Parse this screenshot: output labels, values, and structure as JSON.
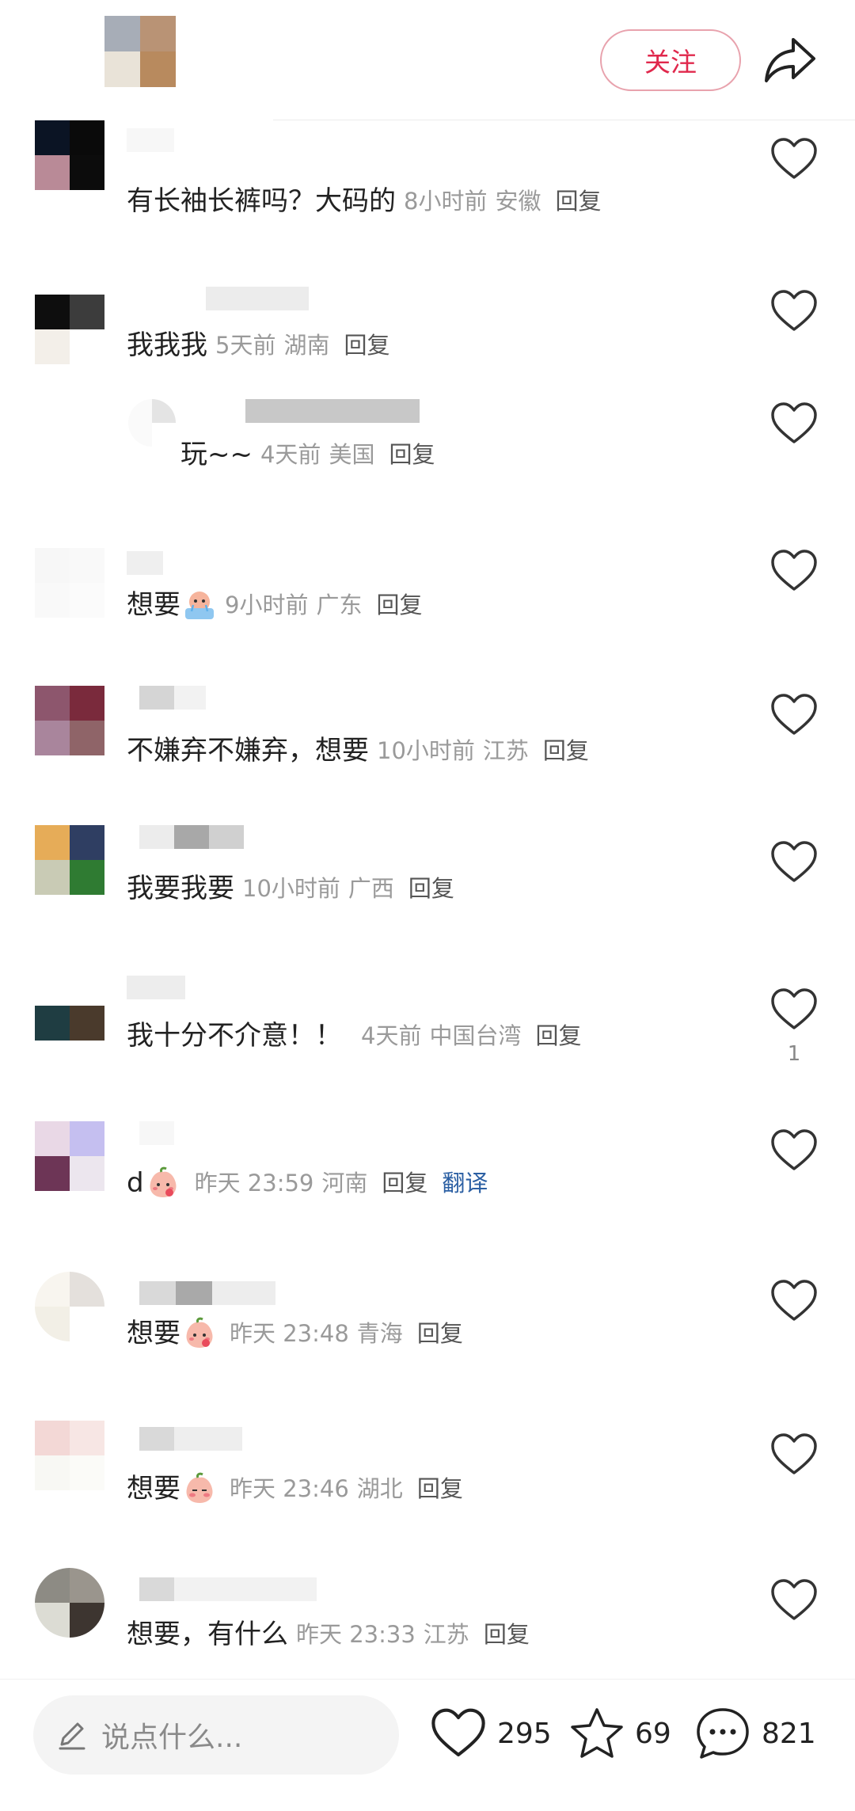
{
  "header": {
    "follow_label": "关注"
  },
  "comments": [
    {
      "text": "有长袖长裤吗？大码的",
      "time": "8小时前",
      "location": "安徽",
      "reply": "回复",
      "like_count": ""
    },
    {
      "text": "我我我",
      "time": "5天前",
      "location": "湖南",
      "reply": "回复",
      "like_count": ""
    },
    {
      "text": "玩~~",
      "time": "4天前",
      "location": "美国",
      "reply": "回复",
      "like_count": ""
    },
    {
      "text": "想要",
      "time": "9小时前",
      "location": "广东",
      "reply": "回复",
      "like_count": "",
      "emoji": "crying-bath-emoji"
    },
    {
      "text": "不嫌弃不嫌弃，想要",
      "time": "10小时前",
      "location": "江苏",
      "reply": "回复",
      "like_count": ""
    },
    {
      "text": "我要我要",
      "time": "10小时前",
      "location": "广西",
      "reply": "回复",
      "like_count": ""
    },
    {
      "text": "我十分不介意！！",
      "time": "4天前",
      "location": "中国台湾",
      "reply": "回复",
      "like_count": "1"
    },
    {
      "text": "d",
      "time": "昨天 23:59",
      "location": "河南",
      "reply": "回复",
      "translate": "翻译",
      "like_count": "",
      "emoji": "blushing-peach-emoji"
    },
    {
      "text": "想要",
      "time": "昨天 23:48",
      "location": "青海",
      "reply": "回复",
      "like_count": "",
      "emoji": "blushing-peach-emoji"
    },
    {
      "text": "想要",
      "time": "昨天 23:46",
      "location": "湖北",
      "reply": "回复",
      "like_count": "",
      "emoji": "shy-peach-emoji"
    },
    {
      "text": "想要，有什么",
      "time": "昨天 23:33",
      "location": "江苏",
      "reply": "回复",
      "like_count": ""
    }
  ],
  "bottom_bar": {
    "input_placeholder": "说点什么...",
    "likes": "295",
    "favorites": "69",
    "comments": "821"
  },
  "colors": {
    "accent": "#e0284c",
    "meta_text": "#9a9a9a",
    "translate": "#2b5fa3"
  },
  "icons": [
    "share-icon",
    "heart-icon",
    "star-icon",
    "comment-bubble-icon",
    "pencil-icon"
  ]
}
